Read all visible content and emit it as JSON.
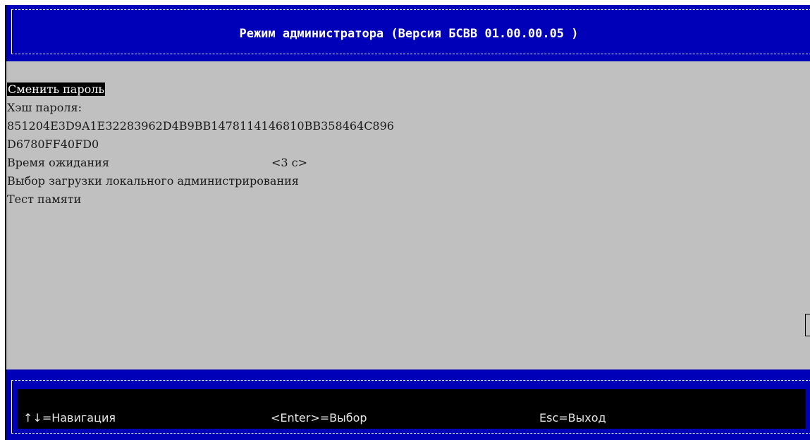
{
  "header": {
    "title": "Режим администратора (Версия БСВВ 01.00.00.05 )"
  },
  "menu": {
    "change_password": "Сменить пароль",
    "hash_label": "Хэш пароля:",
    "hash_line1": "851204E3D9A1E32283962D4B9BB1478114146810BB358464C896",
    "hash_line2": "D6780FF40FD0",
    "timeout_label": "Время ожидания",
    "timeout_value": "<3 с>",
    "local_admin_boot": "Выбор загрузки локального администрирования",
    "memory_test": "Тест памяти"
  },
  "footer": {
    "navigation": "↑↓=Навигация",
    "select": "<Enter>=Выбор",
    "exit": "Esc=Выход"
  },
  "colors": {
    "band": "#0000b8",
    "panel": "#c0c0c0",
    "highlight_bg": "#000000",
    "highlight_fg": "#ffffff"
  }
}
